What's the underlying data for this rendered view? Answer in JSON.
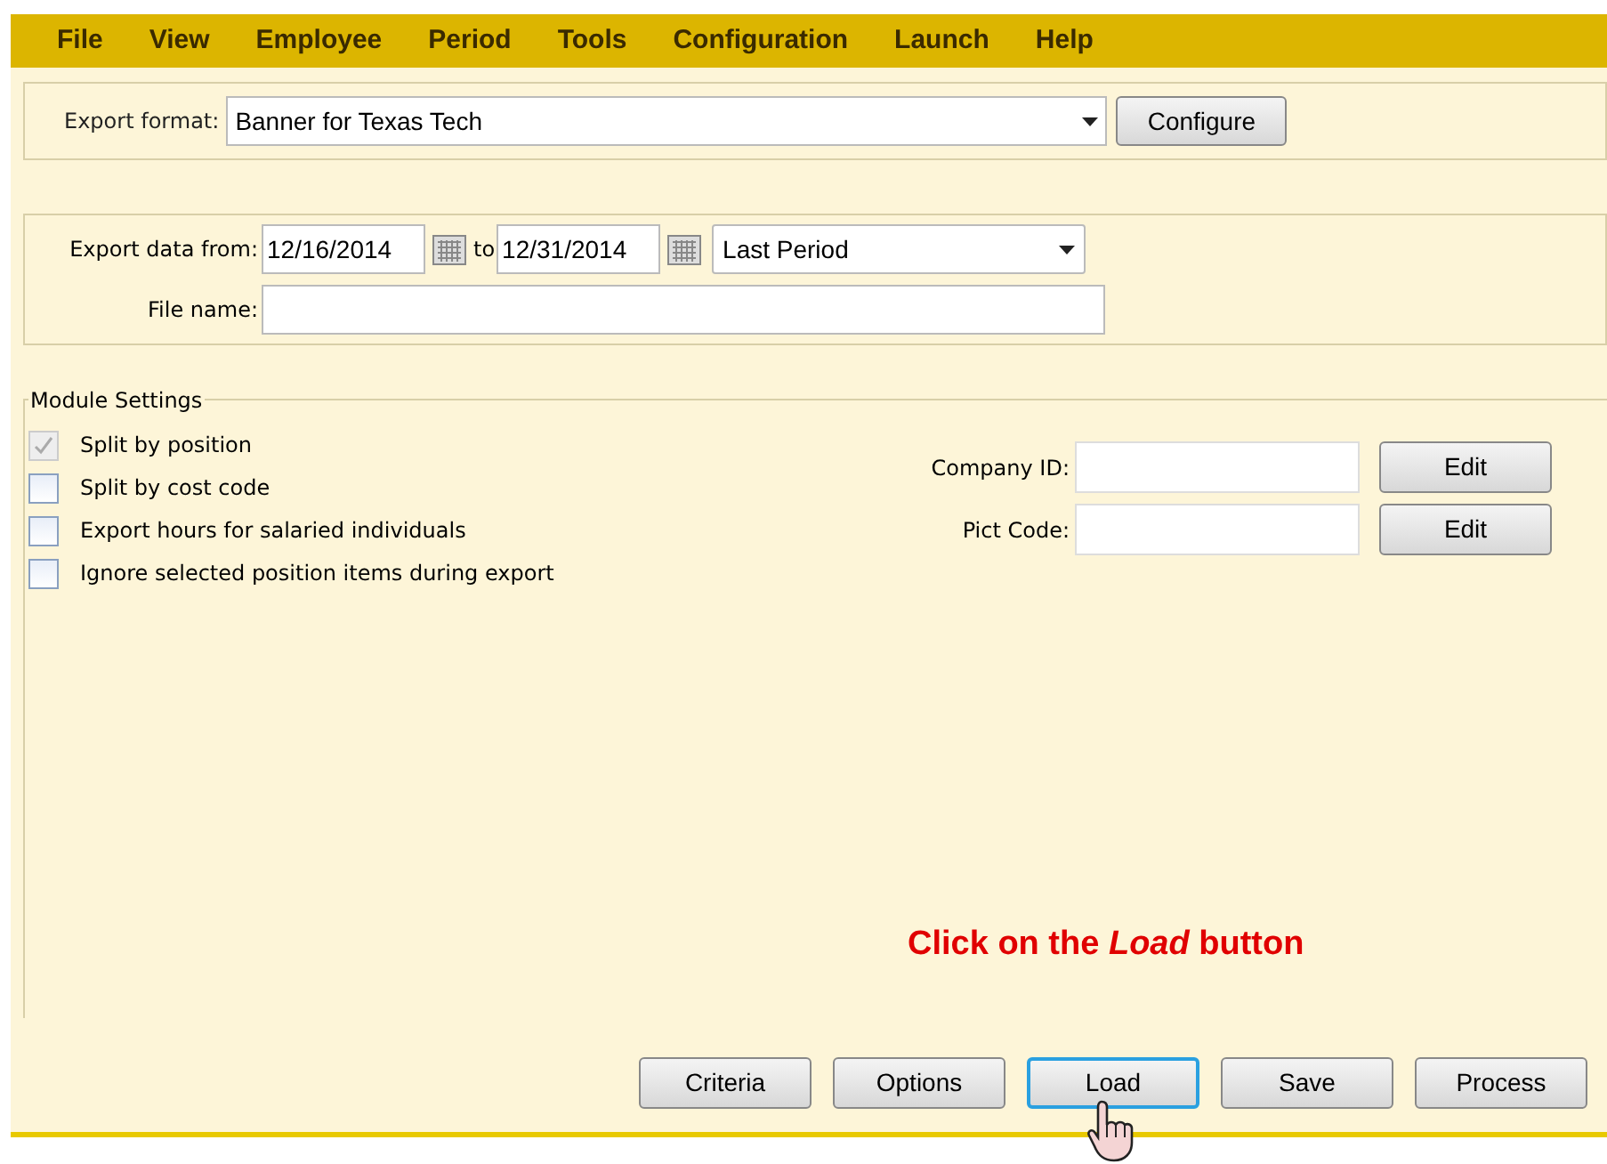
{
  "menu": [
    "File",
    "View",
    "Employee",
    "Period",
    "Tools",
    "Configuration",
    "Launch",
    "Help"
  ],
  "export_format": {
    "label": "Export format:",
    "value": "Banner for Texas Tech",
    "button": "Configure"
  },
  "date_range": {
    "label": "Export data from:",
    "from": "12/16/2014",
    "to_label": "to",
    "to": "12/31/2014",
    "period": "Last Period"
  },
  "file_name": {
    "label": "File name:"
  },
  "module_settings": {
    "title": "Module Settings",
    "options": [
      {
        "label": "Split by position",
        "checked": true,
        "disabled": true
      },
      {
        "label": "Split by cost code",
        "checked": false,
        "disabled": false
      },
      {
        "label": "Export hours for salaried individuals",
        "checked": false,
        "disabled": false
      },
      {
        "label": "Ignore selected position items during export",
        "checked": false,
        "disabled": false
      }
    ],
    "fields": [
      {
        "label": "Company ID:",
        "button": "Edit"
      },
      {
        "label": "Pict Code:",
        "button": "Edit"
      }
    ]
  },
  "annotation": "Click on the *Load* button",
  "buttons": [
    {
      "label": "Criteria",
      "focused": false
    },
    {
      "label": "Options",
      "focused": false
    },
    {
      "label": "Load",
      "focused": true
    },
    {
      "label": "Save",
      "focused": false
    },
    {
      "label": "Process",
      "focused": false
    }
  ]
}
